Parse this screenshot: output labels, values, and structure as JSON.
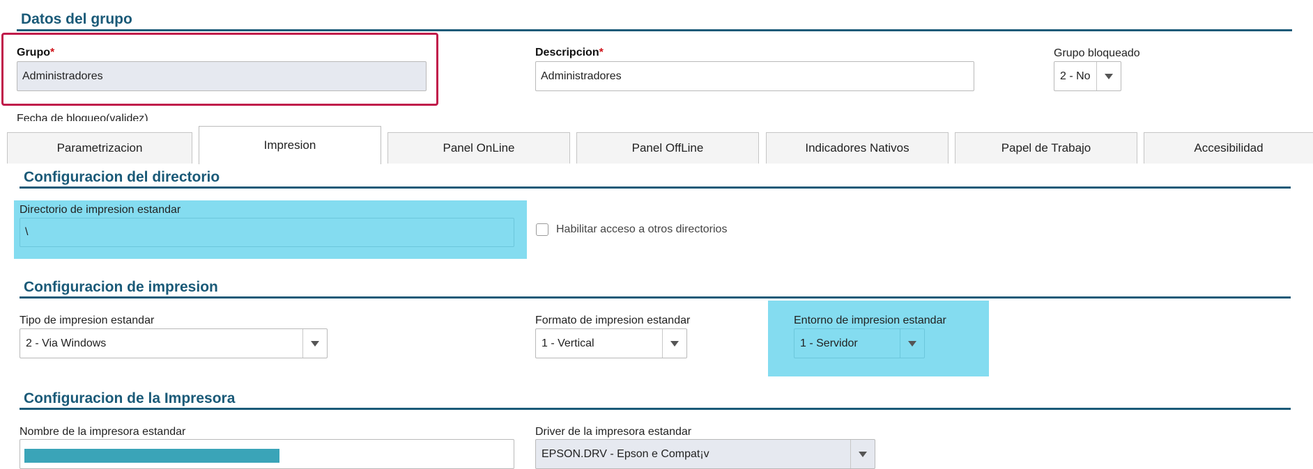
{
  "group_section": {
    "title": "Datos del grupo",
    "grupo_label": "Grupo",
    "grupo_value": "Administradores",
    "descripcion_label": "Descripcion",
    "descripcion_value": "Administradores",
    "bloqueado_label": "Grupo bloqueado",
    "bloqueado_value": "2 - No",
    "fecha_label": "Fecha de bloqueo(validez)",
    "required_mark": "*"
  },
  "tabs": [
    {
      "label": "Parametrizacion",
      "active": false
    },
    {
      "label": "Impresion",
      "active": true
    },
    {
      "label": "Panel OnLine",
      "active": false
    },
    {
      "label": "Panel OffLine",
      "active": false
    },
    {
      "label": "Indicadores Nativos",
      "active": false
    },
    {
      "label": "Papel de Trabajo",
      "active": false
    },
    {
      "label": "Accesibilidad",
      "active": false
    }
  ],
  "directorio_section": {
    "title": "Configuracion del directorio",
    "dir_label": "Directorio de impresion estandar",
    "dir_value": "\\",
    "habilitar_label": "Habilitar acceso a otros directorios",
    "habilitar_checked": false
  },
  "impresion_section": {
    "title": "Configuracion de impresion",
    "tipo_label": "Tipo de impresion estandar",
    "tipo_value": "2 - Via Windows",
    "formato_label": "Formato de impresion estandar",
    "formato_value": "1 - Vertical",
    "entorno_label": "Entorno de impresion estandar",
    "entorno_value": "1 - Servidor"
  },
  "impresora_section": {
    "title": "Configuracion de la Impresora",
    "nombre_label": "Nombre de la impresora estandar",
    "driver_label": "Driver de la impresora estandar",
    "driver_value": "EPSON.DRV - Epson e Compat¡v"
  },
  "colors": {
    "accent": "#1a5a78",
    "highlight_cyan": "#84dcf0",
    "focus_border": "#c0184a",
    "required": "#d0151b"
  }
}
